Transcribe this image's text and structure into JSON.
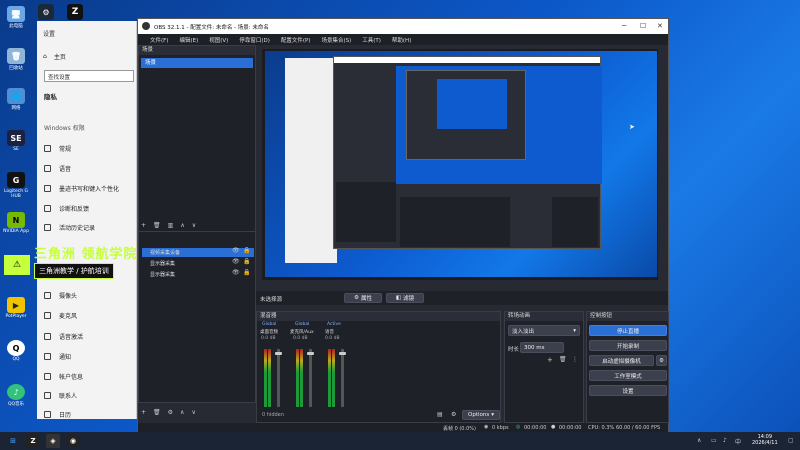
{
  "desktop": {
    "icons": [
      {
        "label": "此电脑",
        "glyph": "🖥"
      },
      {
        "label": "回收站",
        "glyph": "🗑"
      },
      {
        "label": "网络",
        "glyph": "🌐"
      },
      {
        "label": "SE",
        "glyph": "SE"
      },
      {
        "label": "Logitech G HUB",
        "glyph": "G"
      },
      {
        "label": "NVIDIA App",
        "glyph": "N"
      },
      {
        "label": "PotPlayer",
        "glyph": "▶"
      },
      {
        "label": "QQ",
        "glyph": "Q"
      },
      {
        "label": "QQ音乐",
        "glyph": "♪"
      }
    ]
  },
  "settings": {
    "title": "设置",
    "home": "主页",
    "search_placeholder": "查找设置",
    "section_privacy": "隐私",
    "section_windows": "Windows 权限",
    "items": [
      {
        "label": "常规",
        "icon": "lock-icon"
      },
      {
        "label": "语音",
        "icon": "voice-icon"
      },
      {
        "label": "墨迹书写和键入个性化",
        "icon": "pen-icon"
      },
      {
        "label": "诊断和反馈",
        "icon": "feedback-icon"
      },
      {
        "label": "活动历史记录",
        "icon": "history-icon"
      }
    ],
    "items2": [
      {
        "label": "摄像头",
        "icon": "camera-icon"
      },
      {
        "label": "麦克风",
        "icon": "mic-icon"
      },
      {
        "label": "语音激活",
        "icon": "voice-activation-icon"
      },
      {
        "label": "通知",
        "icon": "bell-icon"
      },
      {
        "label": "帐户信息",
        "icon": "account-icon"
      },
      {
        "label": "联系人",
        "icon": "contacts-icon"
      },
      {
        "label": "日历",
        "icon": "calendar-icon"
      }
    ]
  },
  "obs": {
    "title": "OBS 32.1.1 - 配置文件: 未命名 - 场景: 未命名",
    "menu": [
      "文件(F)",
      "编辑(E)",
      "视图(V)",
      "停靠窗口(D)",
      "配置文件(P)",
      "场景集合(S)",
      "工具(T)",
      "帮助(H)"
    ],
    "scenes_header": "场景",
    "scene_item": "场景",
    "sources": [
      {
        "label": "视频采集设备"
      },
      {
        "label": "显示器采集"
      },
      {
        "label": "显示器采集"
      }
    ],
    "no_source": "未选择源",
    "props_btn": "属性",
    "filter_btn": "滤镜",
    "mixer_header": "混音器",
    "mixer_channels": [
      {
        "tag": "Global",
        "name": "桌面音频",
        "db": "0.0 dB"
      },
      {
        "tag": "Global",
        "name": "麦克风/Aux",
        "db": "0.0 dB"
      },
      {
        "tag": "Active",
        "name": "语音",
        "db": "0.0 dB"
      }
    ],
    "hidden": "0 hidden",
    "options": "Options",
    "transitions_header": "转场动画",
    "transition_value": "淡入淡出",
    "duration_label": "时长",
    "duration_value": "300 ms",
    "controls_header": "控制按钮",
    "controls": [
      "停止直播",
      "开始录制",
      "启动虚拟摄像机",
      "工作室模式",
      "设置"
    ],
    "status": {
      "dropped": "丢帧 0 (0.0%)",
      "bitrate": "0 kbps",
      "stream_time": "00:00:00",
      "rec_time": "00:00:00",
      "cpu": "CPU: 0.3%",
      "fps": "60.00 / 60.00 FPS"
    }
  },
  "watermark": {
    "brand": "三角洲 领航学院",
    "sub": "三角洲教学 / 护航培训"
  },
  "taskbar": {
    "time": "14:09",
    "date": "2026/4/11"
  },
  "colors": {
    "accent": "#2a6fd6",
    "watermark_green": "#c6ff3b"
  }
}
